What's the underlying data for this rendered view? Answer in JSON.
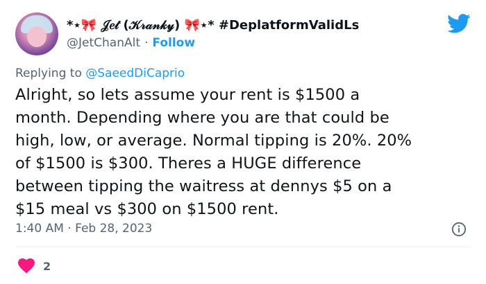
{
  "author": {
    "display_name": "*⋆🎀 𝒥𝑒𝓉 (𝒦𝓇𝒶𝓃𝓀𝓎) 🎀⋆* #DeplatformValidLs",
    "handle": "@JetChanAlt",
    "separator": "·",
    "follow_label": "Follow"
  },
  "reply": {
    "prefix": "Replying to ",
    "mention": "@SaeedDiCaprio"
  },
  "tweet": {
    "lines": [
      "Alright, so lets assume your rent is $1500 a",
      "month. Depending where you are that could be",
      "high, low, or average. Normal tipping is 20%. 20%",
      "of $1500 is $300. Theres a HUGE difference",
      "between tipping the waitress at dennys $5 on a",
      "$15 meal vs $300 on $1500 rent."
    ],
    "time": "1:40 AM",
    "date_separator": "·",
    "date": "Feb 28, 2023"
  },
  "stats": {
    "likes": "2"
  },
  "icons": {
    "brand": "twitter-bird-icon",
    "info": "info-icon",
    "like": "heart-icon"
  },
  "colors": {
    "accent": "#1d9bf0",
    "like": "#f91880",
    "text": "#0f1419",
    "muted": "#536471"
  }
}
